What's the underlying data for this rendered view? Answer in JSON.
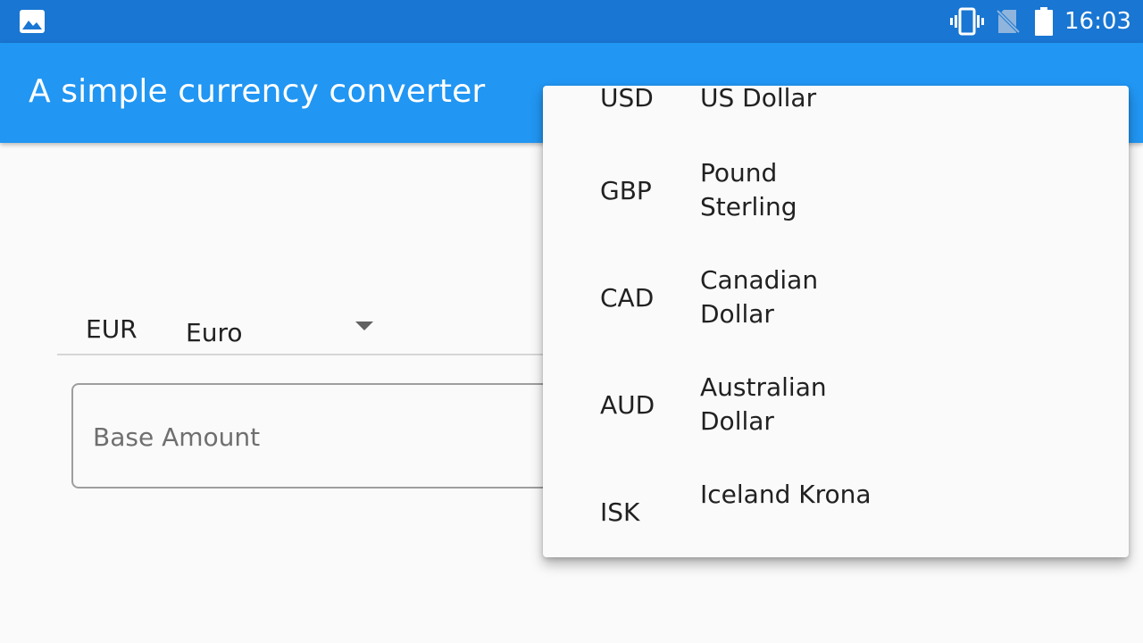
{
  "status_bar": {
    "time": "16:03",
    "icons": [
      "image-icon",
      "vibrate-icon",
      "no-sim-icon",
      "battery-icon"
    ]
  },
  "app_bar": {
    "title": "A simple currency converter",
    "color": "#2196f3"
  },
  "currency_select": {
    "code": "EUR",
    "name": "Euro"
  },
  "amount_field": {
    "value": "",
    "placeholder": "Base Amount"
  },
  "dropdown": {
    "items": [
      {
        "code": "USD",
        "name": "US Dollar"
      },
      {
        "code": "GBP",
        "name": "Pound Sterling"
      },
      {
        "code": "CAD",
        "name": "Canadian Dollar"
      },
      {
        "code": "AUD",
        "name": "Australian Dollar"
      },
      {
        "code": "ISK",
        "name": "Iceland Krona"
      }
    ]
  },
  "colors": {
    "status_bar": "#1976d2",
    "app_bar": "#2196f3",
    "background": "#fafafa"
  }
}
